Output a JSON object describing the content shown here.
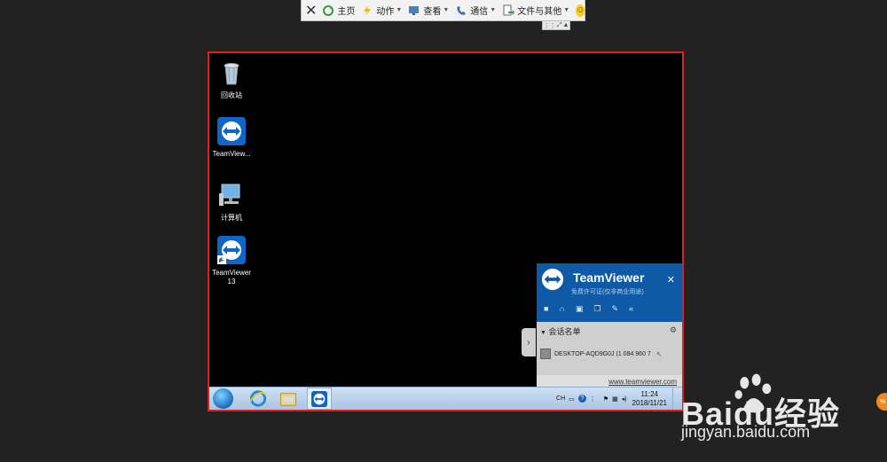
{
  "toolbar": {
    "close_glyph": "✕",
    "home": "主页",
    "actions": "动作",
    "view": "查看",
    "communicate": "通信",
    "files": "文件与其他",
    "smiley": "☺"
  },
  "desktop": {
    "icons": [
      {
        "label": "回收站",
        "icon": "recycle-bin-icon"
      },
      {
        "label": "TeamView...",
        "icon": "teamviewer-icon"
      },
      {
        "label": "计算机",
        "icon": "computer-icon"
      },
      {
        "label": "TeamViewer 13",
        "icon": "teamviewer-shortcut-icon"
      }
    ]
  },
  "tv_panel": {
    "brand": "TeamViewer",
    "license": "免费许可证(仅非商业用途)",
    "session_list_title": "会话名单",
    "session_entry": "DESKTOP-AQD9G0J (1 084 960 7",
    "footer_link": "www.teamviewer.com",
    "close": "✕"
  },
  "taskbar": {
    "time": "11:24",
    "date": "2018/11/21"
  },
  "watermark": {
    "brand": "Baidu经验",
    "url": "jingyan.baidu.com"
  },
  "colors": {
    "border_red": "#e0201a",
    "tv_blue": "#0e5aa7",
    "accent_orange": "#f08a1c"
  }
}
